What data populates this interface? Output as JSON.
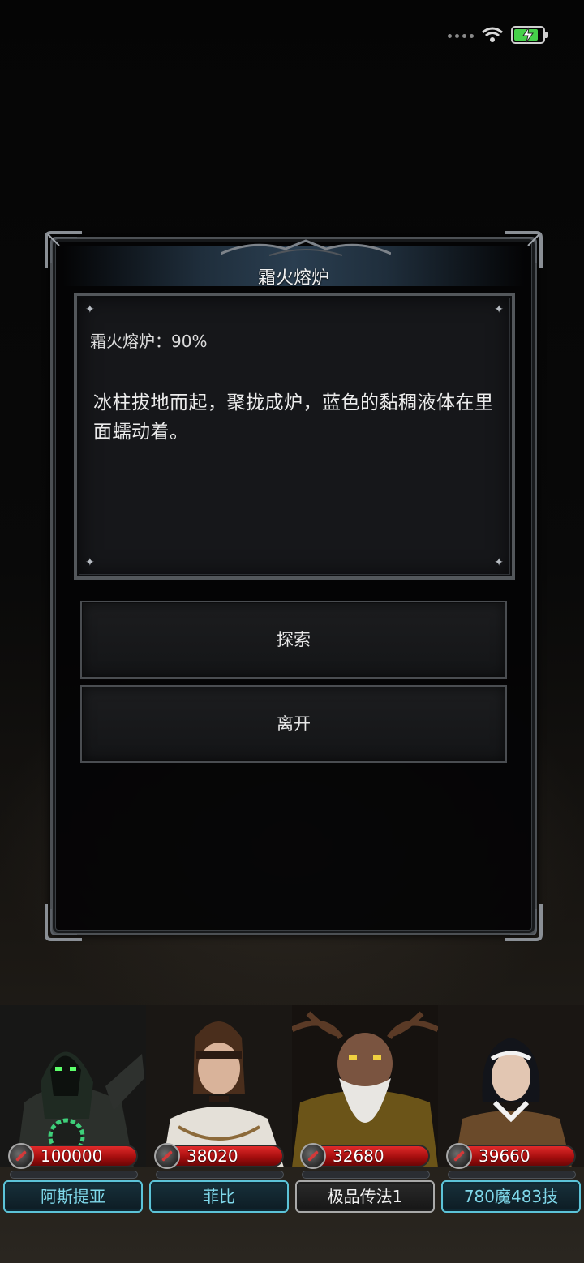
{
  "status_bar": {
    "battery_level": 0.85,
    "battery_color": "#46d14a",
    "charging": true
  },
  "dialog": {
    "title": "霜火熔炉",
    "status_line": "霜火熔炉：90%",
    "description": "冰柱拔地而起，聚拢成炉，蓝色的黏稠液体在里面蠕动着。",
    "options": [
      {
        "label": "探索"
      },
      {
        "label": "离开"
      }
    ]
  },
  "party": [
    {
      "hp": "100000",
      "name": "阿斯提亚",
      "plate_style": "cyan"
    },
    {
      "hp": "38020",
      "name": "菲比",
      "plate_style": "cyan"
    },
    {
      "hp": "32680",
      "name": "极品传法1",
      "plate_style": "plain"
    },
    {
      "hp": "39660",
      "name": "780魔483技",
      "plate_style": "cyan"
    }
  ]
}
